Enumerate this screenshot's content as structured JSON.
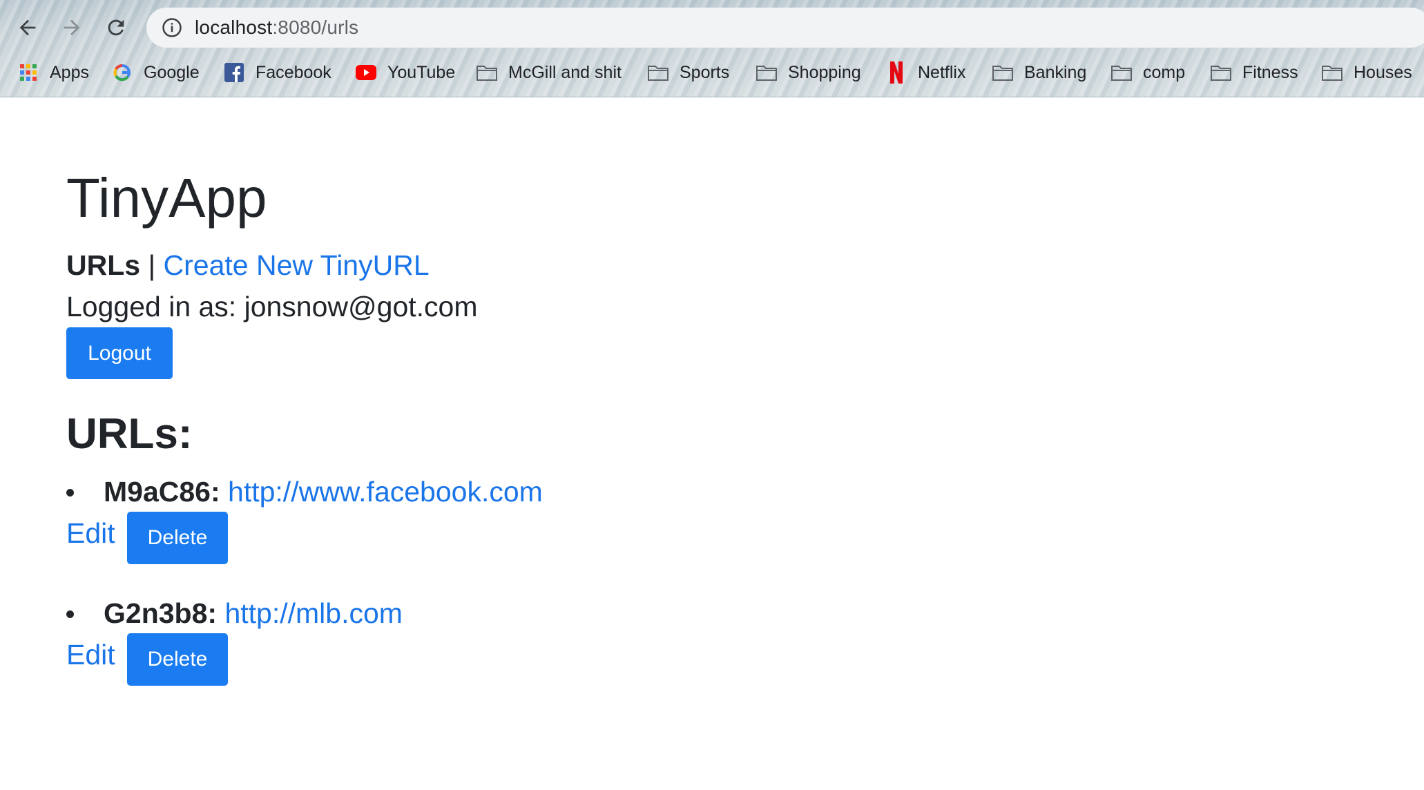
{
  "browser": {
    "url_host": "localhost",
    "url_path": ":8080/urls",
    "bookmarks": [
      {
        "label": "Apps",
        "icon": "apps-grid-icon"
      },
      {
        "label": "Google",
        "icon": "google-icon"
      },
      {
        "label": "Facebook",
        "icon": "facebook-icon"
      },
      {
        "label": "YouTube",
        "icon": "youtube-icon"
      },
      {
        "label": "McGill and shit",
        "icon": "folder-icon"
      },
      {
        "label": "Sports",
        "icon": "folder-icon"
      },
      {
        "label": "Shopping",
        "icon": "folder-icon"
      },
      {
        "label": "Netflix",
        "icon": "netflix-icon"
      },
      {
        "label": "Banking",
        "icon": "folder-icon"
      },
      {
        "label": "comp",
        "icon": "folder-icon"
      },
      {
        "label": "Fitness",
        "icon": "folder-icon"
      },
      {
        "label": "Houses",
        "icon": "folder-icon"
      }
    ]
  },
  "page": {
    "brand": "TinyApp",
    "nav_current": "URLs",
    "nav_separator": "|",
    "nav_create": "Create New TinyURL",
    "logged_in_label": "Logged in as: jonsnow@got.com",
    "logout_label": "Logout",
    "urls_heading": "URLs:",
    "urls": [
      {
        "short": "M9aC86:",
        "long": "http://www.facebook.com",
        "edit": "Edit",
        "delete": "Delete"
      },
      {
        "short": "G2n3b8:",
        "long": "http://mlb.com",
        "edit": "Edit",
        "delete": "Delete"
      }
    ]
  },
  "colors": {
    "link": "#1a75e8",
    "button": "#1a7cf0",
    "text": "#212529"
  }
}
